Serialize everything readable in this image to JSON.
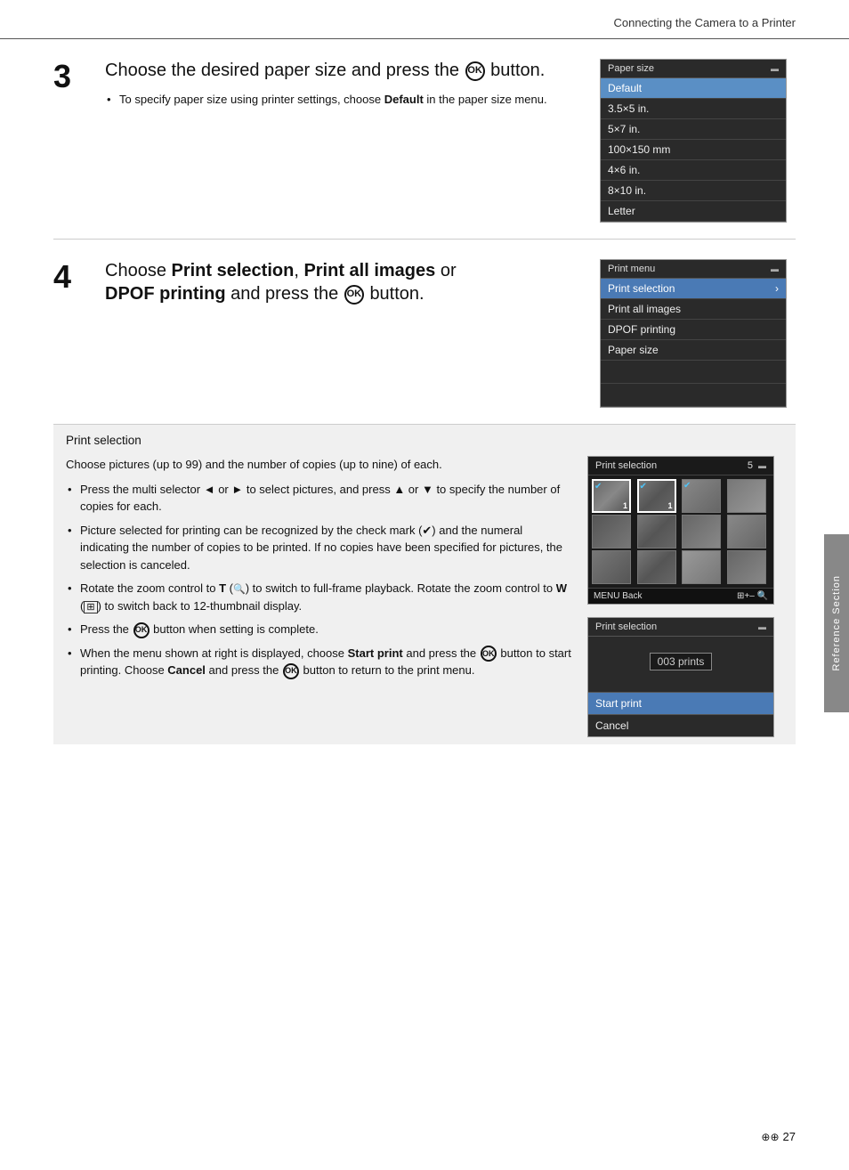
{
  "header": {
    "title": "Connecting the Camera to a Printer"
  },
  "step3": {
    "number": "3",
    "title_part1": "Choose the desired paper size and press the",
    "title_ok": "OK",
    "title_part2": "button.",
    "bullet1_prefix": "To specify paper size using printer settings, choose",
    "bullet1_bold": "Default",
    "bullet1_suffix": "in the paper size menu.",
    "menu": {
      "title": "Paper size",
      "items": [
        {
          "label": "Default",
          "selected": true
        },
        {
          "label": "3.5×5 in.",
          "selected": false
        },
        {
          "label": "5×7 in.",
          "selected": false
        },
        {
          "label": "100×150 mm",
          "selected": false
        },
        {
          "label": "4×6 in.",
          "selected": false
        },
        {
          "label": "8×10 in.",
          "selected": false
        },
        {
          "label": "Letter",
          "selected": false
        }
      ]
    }
  },
  "step4": {
    "number": "4",
    "title_choose": "Choose",
    "title_bold1": "Print selection",
    "title_comma": ",",
    "title_bold2": "Print all images",
    "title_or": "or",
    "title_bold3": "DPOF printing",
    "title_and": "and press the",
    "title_ok": "OK",
    "title_end": "button.",
    "menu": {
      "title": "Print menu",
      "items": [
        {
          "label": "Print selection",
          "selected": true,
          "arrow": "›"
        },
        {
          "label": "Print all images",
          "selected": false
        },
        {
          "label": "DPOF printing",
          "selected": false
        },
        {
          "label": "Paper size",
          "selected": false
        }
      ]
    }
  },
  "print_selection_section": {
    "title": "Print selection",
    "intro": "Choose pictures (up to 99) and the number of copies (up to nine) of each.",
    "bullets": [
      "Press the multi selector ◄ or ► to select pictures, and press ▲ or ▼ to specify the number of copies for each.",
      "Picture selected for printing can be recognized by the check mark (✔) and the numeral indicating the number of copies to be printed. If no copies have been specified for pictures, the selection is canceled.",
      "Rotate the zoom control to T (🔍) to switch to full-frame playback. Rotate the zoom control to W (⊞) to switch back to 12-thumbnail display.",
      "Press the OK button when setting is complete.",
      "When the menu shown at right is displayed, choose Start print and press the OK button to start printing. Choose Cancel and press the OK button to return to the print menu."
    ],
    "thumb_box": {
      "title": "Print selection",
      "count": "5",
      "footer_left": "MENU Back",
      "footer_right": "⊞+– 🔍"
    },
    "confirm_box": {
      "title": "Print selection",
      "prints_label": "003 prints",
      "items": [
        {
          "label": "Start print",
          "active": true
        },
        {
          "label": "Cancel",
          "active": false
        }
      ]
    }
  },
  "reference_tab": {
    "label": "Reference Section"
  },
  "footer": {
    "icon": "⊕⊕",
    "page": "27"
  }
}
